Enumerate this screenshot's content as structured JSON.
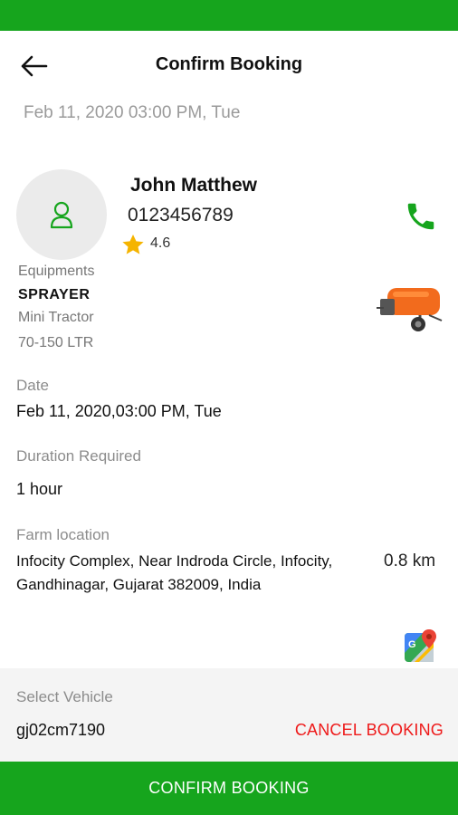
{
  "header": {
    "title": "Confirm Booking",
    "datetime": "Feb 11, 2020 03:00 PM, Tue",
    "back_icon": "arrow-left-icon"
  },
  "provider": {
    "name": "John Matthew",
    "phone": "0123456789",
    "rating": "4.6",
    "avatar_icon": "user-icon",
    "call_icon": "phone-icon"
  },
  "equipment": {
    "label": "Equipments",
    "name": "SPRAYER",
    "type": "Mini Tractor",
    "capacity": "70-150 LTR",
    "image_icon": "sprayer-icon"
  },
  "details": {
    "date_label": "Date",
    "date_value": "Feb 11, 2020,03:00 PM, Tue",
    "duration_label": "Duration Required",
    "duration_value": "1 hour",
    "farm_label": "Farm location",
    "farm_value": "Infocity Complex, Near Indroda Circle, Infocity, Gandhinagar, Gujarat 382009, India",
    "distance": "0.8 km",
    "map_icon": "google-maps-icon"
  },
  "vehicle": {
    "label": "Select Vehicle",
    "value": "gj02cm7190"
  },
  "actions": {
    "cancel_label": "CANCEL BOOKING",
    "confirm_label": "CONFIRM BOOKING"
  },
  "colors": {
    "brand_green": "#16a51d",
    "danger_red": "#ee1a1a",
    "star_yellow": "#f5b400"
  }
}
